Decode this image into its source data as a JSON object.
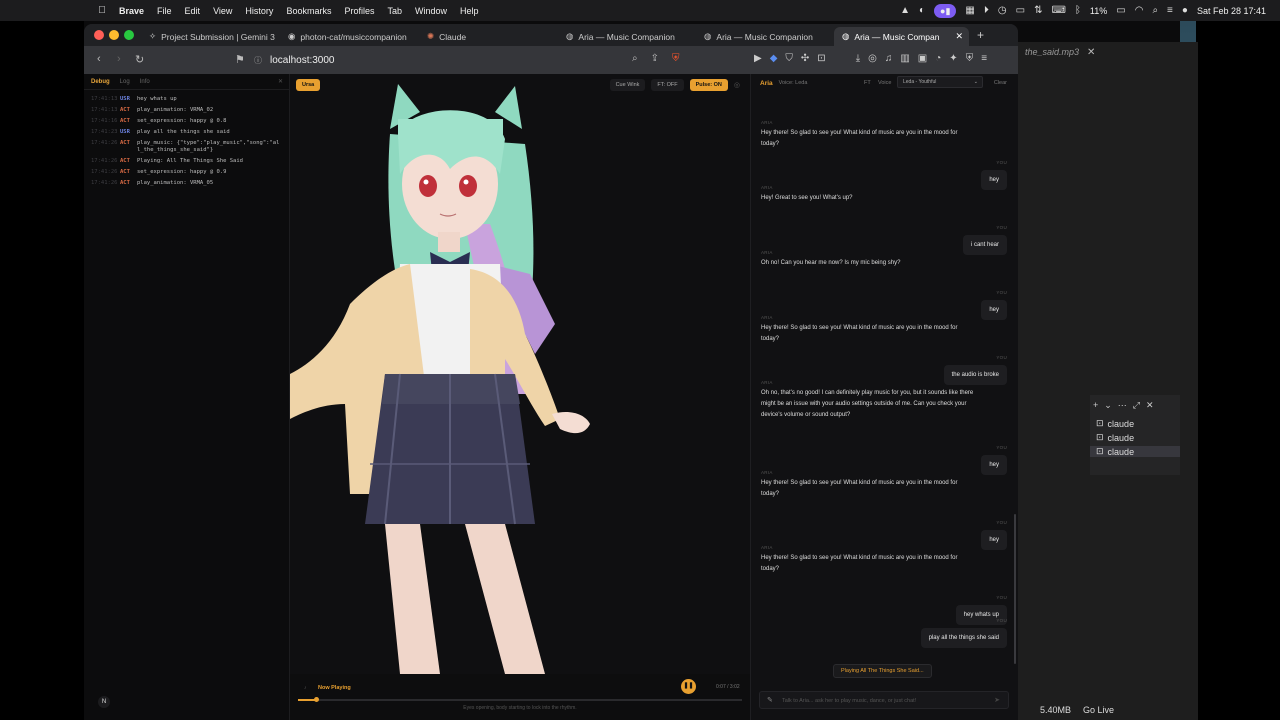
{
  "menubar": {
    "apple": "",
    "app": "Brave",
    "items": [
      "File",
      "Edit",
      "View",
      "History",
      "Bookmarks",
      "Profiles",
      "Tab",
      "Window",
      "Help"
    ],
    "battery": "11%",
    "datetime": "Sat Feb 28  17:41"
  },
  "browser": {
    "tabs": [
      {
        "label": "Project Submission | Gemini 3",
        "icon": "gemini-icon"
      },
      {
        "label": "photon-cat/musiccompanion",
        "icon": "github-icon"
      },
      {
        "label": "Claude",
        "icon": "claude-icon"
      },
      {
        "label": "Aria — Music Companion",
        "icon": "globe-icon"
      },
      {
        "label": "Aria — Music Companion",
        "icon": "globe-icon"
      },
      {
        "label": "Aria — Music Compan",
        "icon": "globe-icon"
      }
    ],
    "url": "localhost:3000"
  },
  "debug": {
    "tabs": [
      "Debug",
      "Log",
      "Info"
    ],
    "lines": [
      {
        "ts": "17:41:13",
        "kind": "USR",
        "msg": "hey whats up"
      },
      {
        "ts": "17:41:13",
        "kind": "ACT",
        "msg": "play_animation: VRMA_02"
      },
      {
        "ts": "17:41:16",
        "kind": "ACT",
        "msg": "set_expression: happy @ 0.8"
      },
      {
        "ts": "17:41:23",
        "kind": "USR",
        "msg": "play all the things she said"
      },
      {
        "ts": "17:41:26",
        "kind": "ACT",
        "msg": "play_music: {\"type\":\"play_music\",\"song\":\"all_the_things_she_said\"}"
      },
      {
        "ts": "17:41:26",
        "kind": "ACT",
        "msg": "Playing: All The Things She Said"
      },
      {
        "ts": "17:41:26",
        "kind": "ACT",
        "msg": "set_expression: happy @ 0.9"
      },
      {
        "ts": "17:41:26",
        "kind": "ACT",
        "msg": "play_animation: VRMA_05"
      }
    ]
  },
  "stage": {
    "badge": "Ursa",
    "buttons": [
      "Cue Wink",
      "FT: OFF",
      "Pulse: ON"
    ],
    "player": {
      "label": "Now Playing",
      "time": "0:07 / 3:02",
      "progress": 0.04,
      "caption": "Eyes opening, body starting to lock into the rhythm."
    }
  },
  "chat": {
    "name": "Aria",
    "voice_hint": "Voice: Leda",
    "ft": "FT",
    "voice_label": "Voice",
    "voice_select": "Leda - Youthful",
    "clear": "Clear",
    "ai_label": "ARIA",
    "user_label": "YOU",
    "messages": [
      {
        "role": "ai",
        "text": "Hey there! So glad to see you! What kind of music are you in the mood for today?"
      },
      {
        "role": "user",
        "text": "hey"
      },
      {
        "role": "ai",
        "text": "Hey! Great to see you! What's up?"
      },
      {
        "role": "user",
        "text": "i cant hear"
      },
      {
        "role": "ai",
        "text": "Oh no! Can you hear me now? Is my mic being shy?"
      },
      {
        "role": "user",
        "text": "hey"
      },
      {
        "role": "ai",
        "text": "Hey there! So glad to see you! What kind of music are you in the mood for today?"
      },
      {
        "role": "user",
        "text": "the audio is broke"
      },
      {
        "role": "ai",
        "text": "Oh no, that's no good! I can definitely play music for you, but it sounds like there might be an issue with your audio settings outside of me. Can you check your device's volume or sound output?"
      },
      {
        "role": "user",
        "text": "hey"
      },
      {
        "role": "ai",
        "text": "Hey there! So glad to see you! What kind of music are you in the mood for today?"
      },
      {
        "role": "user",
        "text": "hey"
      },
      {
        "role": "ai",
        "text": "Hey there! So glad to see you! What kind of music are you in the mood for today?"
      },
      {
        "role": "user",
        "text": "hey whats up"
      },
      {
        "role": "user",
        "text": "play all the things she said"
      }
    ],
    "chip": "Playing All The Things She Said...",
    "input_placeholder": "Talk to Aria... ask her to play music, dance, or just chat!"
  },
  "background_window": {
    "tab": "the_said.mp3",
    "items": [
      "claude",
      "claude",
      "claude"
    ],
    "status": [
      "5.40MB",
      "Go Live"
    ]
  },
  "colors": {
    "accent": "#e8a030",
    "usr": "#6b82e0",
    "act": "#d86a44"
  }
}
